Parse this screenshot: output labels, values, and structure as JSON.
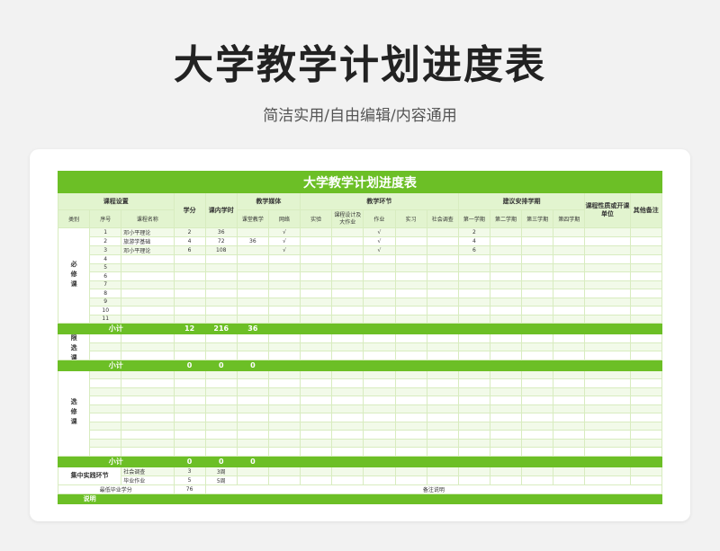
{
  "header": {
    "title": "大学教学计划进度表",
    "subtitle": "简洁实用/自由编辑/内容通用"
  },
  "sheet": {
    "title": "大学教学计划进度表",
    "groups": {
      "course_setting": "课程设置",
      "credit": "学分",
      "hours": "课内学时",
      "media": "教学媒体",
      "links": "教学环节",
      "semesters": "建议安排学期",
      "nature": "课程性质或开课单位",
      "remarks": "其他备注"
    },
    "cols": {
      "category": "类别",
      "seq": "序号",
      "name": "课程名称",
      "media_lecture": "课堂教学",
      "media_online": "网络",
      "exp": "实验",
      "design": "课程设计及大作业",
      "homework": "作业",
      "practice": "实习",
      "survey": "社会调查",
      "sem1": "第一学期",
      "sem2": "第二学期",
      "sem3": "第三学期",
      "sem4": "第四学期"
    },
    "required": {
      "label": "必修课",
      "rows": [
        {
          "seq": "1",
          "name": "邓小平理论",
          "credit": "2",
          "hours": "36",
          "lecture": "",
          "online": "√",
          "homework": "√",
          "sem1": "2"
        },
        {
          "seq": "2",
          "name": "旅游学基础",
          "credit": "4",
          "hours": "72",
          "lecture": "36",
          "online": "√",
          "homework": "√",
          "sem1": "4"
        },
        {
          "seq": "3",
          "name": "邓小平理论",
          "credit": "6",
          "hours": "108",
          "lecture": "",
          "online": "√",
          "homework": "√",
          "sem1": "6"
        },
        {
          "seq": "4"
        },
        {
          "seq": "5"
        },
        {
          "seq": "6"
        },
        {
          "seq": "7"
        },
        {
          "seq": "8"
        },
        {
          "seq": "9"
        },
        {
          "seq": "10"
        },
        {
          "seq": "11"
        }
      ],
      "subtotal": {
        "label": "小计",
        "credit": "12",
        "hours": "216",
        "lecture": "36"
      }
    },
    "limited": {
      "label": "限选课",
      "subtotal": {
        "label": "小计",
        "credit": "0",
        "hours": "0",
        "lecture": "0"
      }
    },
    "elective": {
      "label": "选修课",
      "subtotal": {
        "label": "小计",
        "credit": "0",
        "hours": "0",
        "lecture": "0"
      }
    },
    "practice": {
      "label": "集中实践环节",
      "rows": [
        {
          "name": "社会调查",
          "credit": "3",
          "hours": "3周"
        },
        {
          "name": "毕业作业",
          "credit": "5",
          "hours": "5周"
        }
      ]
    },
    "min_credit": {
      "label": "最低毕业学分",
      "value": "76",
      "remark": "备注说明"
    },
    "note": "说明"
  }
}
